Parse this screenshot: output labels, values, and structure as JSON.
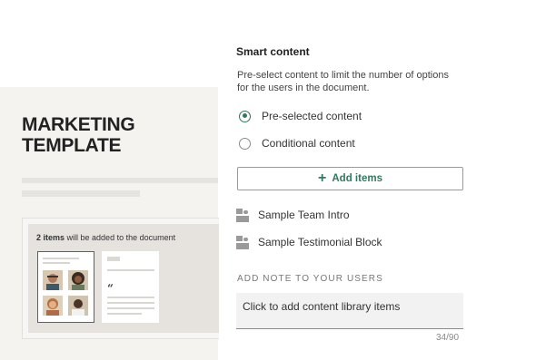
{
  "preview": {
    "title": "MARKETING\nTEMPLATE",
    "card": {
      "count": "2 items",
      "caption": " will be added to the document",
      "quote_mark": "“"
    }
  },
  "panel": {
    "title": "Smart content",
    "description": "Pre-select content to limit the number of options for the users in the document.",
    "options": [
      {
        "label": "Pre-selected content",
        "checked": true
      },
      {
        "label": "Conditional content",
        "checked": false
      }
    ],
    "add_button": {
      "label": "Add items",
      "icon": "plus-icon"
    },
    "items": [
      {
        "label": "Sample Team Intro",
        "icon": "content-block-icon"
      },
      {
        "label": "Sample Testimonial Block",
        "icon": "content-block-icon"
      }
    ],
    "note": {
      "label": "ADD NOTE TO YOUR USERS",
      "value": "Click to add content library items",
      "counter": "34/90"
    },
    "accent": "#2f7a5e"
  }
}
